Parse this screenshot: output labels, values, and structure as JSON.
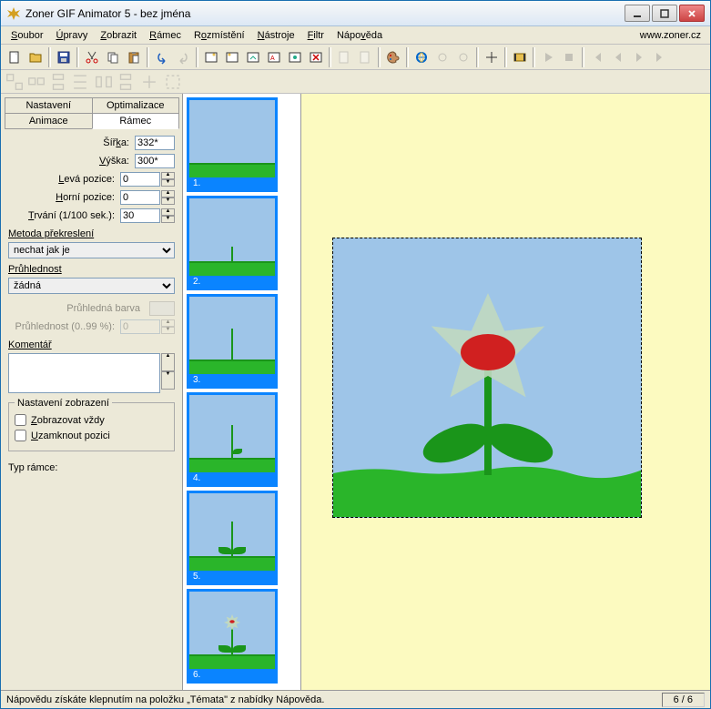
{
  "title": "Zoner GIF Animator 5 - bez jména",
  "url": "www.zoner.cz",
  "menu": [
    "Soubor",
    "Úpravy",
    "Zobrazit",
    "Rámec",
    "Rozmístění",
    "Nástroje",
    "Filtr",
    "Nápověda"
  ],
  "tabs": {
    "nastaveni": "Nastavení",
    "optimalizace": "Optimalizace",
    "animace": "Animace",
    "ramec": "Rámec"
  },
  "props": {
    "sirka_label": "Šířka:",
    "sirka": "332*",
    "vyska_label": "Výška:",
    "vyska": "300*",
    "leva_label": "Levá pozice:",
    "leva": "0",
    "horni_label": "Horní pozice:",
    "horni": "0",
    "trvani_label": "Trvání (1/100 sek.):",
    "trvani": "30"
  },
  "redraw": {
    "label": "Metoda překreslení",
    "value": "nechat jak je"
  },
  "trans": {
    "label": "Průhlednost",
    "value": "žádná",
    "color_label": "Průhledná barva",
    "pct_label": "Průhlednost (0..99 %):",
    "pct": "0"
  },
  "comment_label": "Komentář",
  "display": {
    "legend": "Nastavení zobrazení",
    "always": "Zobrazovat vždy",
    "lock": "Uzamknout pozici"
  },
  "frametype_label": "Typ rámce:",
  "frames": [
    "1.",
    "2.",
    "3.",
    "4.",
    "5.",
    "6."
  ],
  "status": {
    "text": "Nápovědu získáte klepnutím na položku „Témata\" z nabídky Nápověda.",
    "counter": "6 / 6"
  }
}
